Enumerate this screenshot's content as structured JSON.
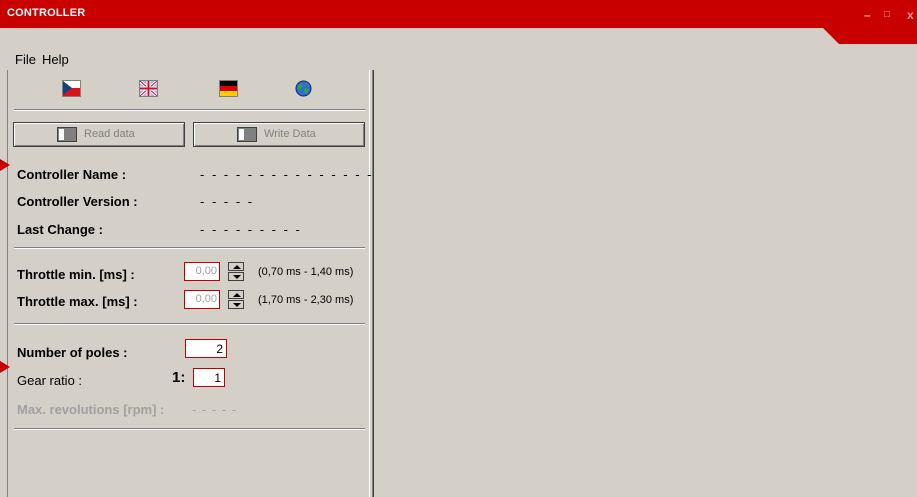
{
  "window": {
    "title": "CONTROLLER",
    "controls": [
      "–",
      "□",
      "x"
    ]
  },
  "menu": [
    "File",
    "Help"
  ],
  "flags": [
    "czech-flag-icon",
    "uk-flag-icon",
    "german-flag-icon",
    "globe-icon"
  ],
  "buttons": {
    "read": "Read data",
    "write": "Write Data"
  },
  "info": {
    "name_label": "Controller Name :",
    "name_value": "- - - - - - - - - - - - - - -",
    "version_label": "Controller Version :",
    "version_value": "- - - - -",
    "change_label": "Last Change :",
    "change_value": "- - - - - - - - -"
  },
  "throttle": {
    "min_label": "Throttle min. [ms] :",
    "min_value": "0,00",
    "min_range": "(0,70 ms - 1,40 ms)",
    "max_label": "Throttle max. [ms] :",
    "max_value": "0,00",
    "max_range": "(1,70 ms - 2,30 ms)"
  },
  "motor": {
    "poles_label": "Number of poles :",
    "poles_value": "2",
    "gear_label": "Gear ratio :",
    "gear_prefix": "1:",
    "gear_value": "1",
    "maxrev_label": "Max. revolutions [rpm] :",
    "maxrev_value": "- - - - -"
  },
  "colors": {
    "accent": "#c80000",
    "panel": "#d4d0c8"
  }
}
